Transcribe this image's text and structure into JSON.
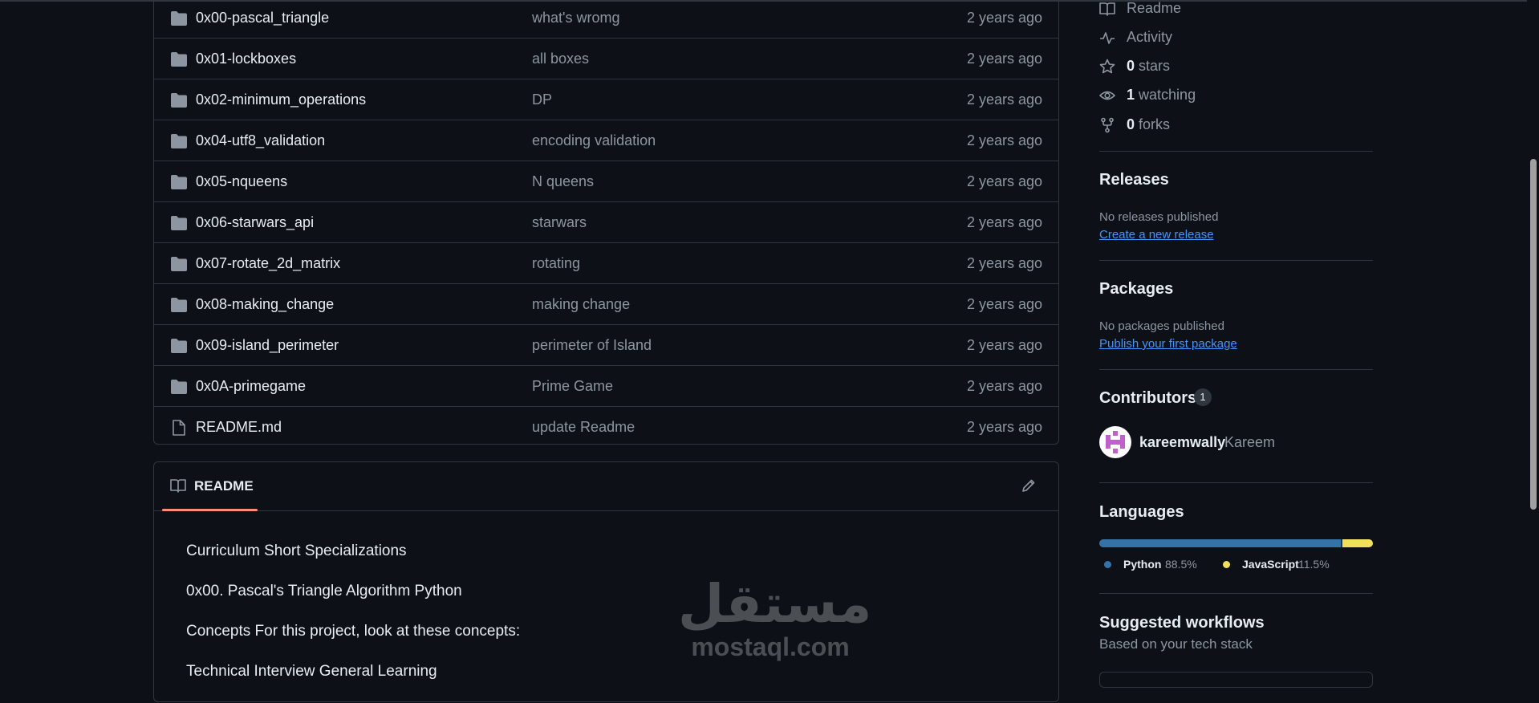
{
  "files": [
    {
      "name": "0x00-pascal_triangle",
      "message": "what's wromg",
      "age": "2 years ago",
      "type": "folder"
    },
    {
      "name": "0x01-lockboxes",
      "message": "all boxes",
      "age": "2 years ago",
      "type": "folder"
    },
    {
      "name": "0x02-minimum_operations",
      "message": "DP",
      "age": "2 years ago",
      "type": "folder"
    },
    {
      "name": "0x04-utf8_validation",
      "message": "encoding validation",
      "age": "2 years ago",
      "type": "folder"
    },
    {
      "name": "0x05-nqueens",
      "message": "N queens",
      "age": "2 years ago",
      "type": "folder"
    },
    {
      "name": "0x06-starwars_api",
      "message": "starwars",
      "age": "2 years ago",
      "type": "folder"
    },
    {
      "name": "0x07-rotate_2d_matrix",
      "message": "rotating",
      "age": "2 years ago",
      "type": "folder"
    },
    {
      "name": "0x08-making_change",
      "message": "making change",
      "age": "2 years ago",
      "type": "folder"
    },
    {
      "name": "0x09-island_perimeter",
      "message": "perimeter of Island",
      "age": "2 years ago",
      "type": "folder"
    },
    {
      "name": "0x0A-primegame",
      "message": "Prime Game",
      "age": "2 years ago",
      "type": "folder"
    },
    {
      "name": "README.md",
      "message": "update Readme",
      "age": "2 years ago",
      "type": "file"
    }
  ],
  "readme": {
    "tab_label": "README",
    "lines": [
      "Curriculum Short Specializations",
      "0x00. Pascal's Triangle Algorithm Python",
      "Concepts For this project, look at these concepts:",
      "Technical Interview General Learning"
    ]
  },
  "watermark": {
    "arabic": "مستقل",
    "latin": "mostaql.com"
  },
  "sidebar": {
    "meta": {
      "readme": "Readme",
      "activity": "Activity",
      "stars_count": "0",
      "stars_label": "stars",
      "watching_count": "1",
      "watching_label": "watching",
      "forks_count": "0",
      "forks_label": "forks"
    },
    "releases": {
      "title": "Releases",
      "empty": "No releases published",
      "link": "Create a new release"
    },
    "packages": {
      "title": "Packages",
      "empty": "No packages published",
      "link": "Publish your first package"
    },
    "contributors": {
      "title": "Contributors",
      "count": "1",
      "login": "kareemwally",
      "name": "Kareem"
    },
    "languages": {
      "title": "Languages",
      "items": [
        {
          "name": "Python",
          "percent": "88.5%",
          "share": 0.885,
          "color": "#3572A5"
        },
        {
          "name": "JavaScript",
          "percent": "11.5%",
          "share": 0.115,
          "color": "#f1e05a"
        }
      ]
    },
    "workflows": {
      "title": "Suggested workflows",
      "subtitle": "Based on your tech stack"
    }
  },
  "colors": {
    "background": "#0d1117",
    "border": "#30363d",
    "link": "#4493f8",
    "tab_underline": "#fd8c73"
  }
}
